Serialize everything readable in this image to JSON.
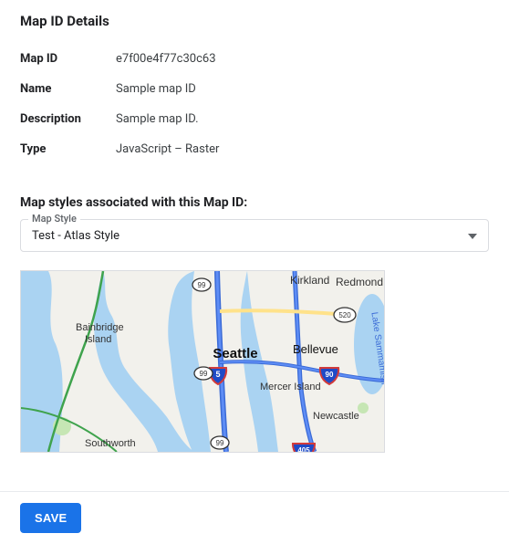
{
  "header": {
    "title": "Map ID Details"
  },
  "details": {
    "rows": [
      {
        "label": "Map ID",
        "value": "e7f00e4f77c30c63"
      },
      {
        "label": "Name",
        "value": "Sample map ID"
      },
      {
        "label": "Description",
        "value": "Sample map ID."
      },
      {
        "label": "Type",
        "value": "JavaScript – Raster"
      }
    ]
  },
  "styles": {
    "heading": "Map styles associated with this Map ID:",
    "select_label": "Map Style",
    "selected": "Test - Atlas Style"
  },
  "map": {
    "labels": {
      "seattle": "Seattle",
      "bellevue": "Bellevue",
      "kirkland": "Kirkland",
      "redmond": "Redmond",
      "mercer": "Mercer Island",
      "newcastle": "Newcastle",
      "bainbridge_top": "Bainbridge",
      "bainbridge_bot": "Island",
      "southworth": "Southworth",
      "sammamish": "Lake Sammamish"
    },
    "shields": {
      "i5": "5",
      "i405": "405",
      "sr520": "520",
      "sr99": "99"
    }
  },
  "footer": {
    "save": "SAVE"
  }
}
